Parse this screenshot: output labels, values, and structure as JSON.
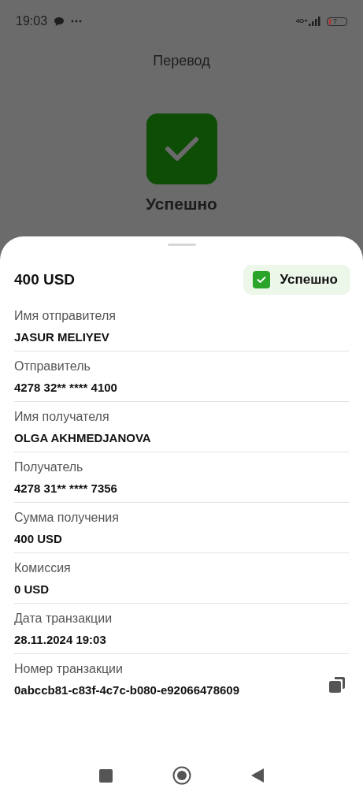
{
  "status_bar": {
    "time": "19:03",
    "network": "4G+",
    "battery": "7"
  },
  "header": {
    "title": "Перевод"
  },
  "result": {
    "status": "Успешно"
  },
  "sheet": {
    "amount": "400 USD",
    "badge": {
      "label": "Успешно",
      "checked": true
    },
    "fields": [
      {
        "label": "Имя отправителя",
        "value": "JASUR MELIYEV"
      },
      {
        "label": "Отправитель",
        "value": "4278 32** **** 4100"
      },
      {
        "label": "Имя получателя",
        "value": "OLGA AKHMEDJANOVA"
      },
      {
        "label": "Получатель",
        "value": "4278 31** **** 7356"
      },
      {
        "label": "Сумма получения",
        "value": "400 USD"
      },
      {
        "label": "Комиссия",
        "value": "0 USD"
      },
      {
        "label": "Дата транзакции",
        "value": "28.11.2024 19:03"
      },
      {
        "label": "Номер транзакции",
        "value": "0abccb81-c83f-4c7c-b080-e92066478609",
        "kind": "copyable"
      }
    ]
  }
}
